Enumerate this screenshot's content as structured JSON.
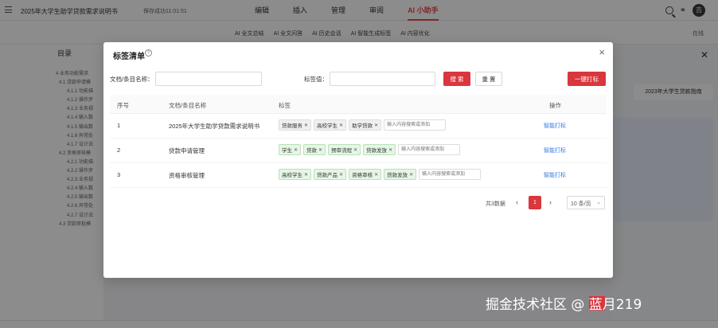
{
  "app": {
    "doc_title": "2025年大学生助学贷款需求说明书",
    "save_status": "保存成功11:01:51",
    "nav": [
      "编辑",
      "插入",
      "管理",
      "审阅",
      "AI 小助手"
    ],
    "avatar_text": "吉"
  },
  "ai_bar": {
    "items": [
      "AI 全文总结",
      "AI 全文问答",
      "AI 历史会话",
      "AI 智能生成标签",
      "AI 内容优化"
    ],
    "online": "在线"
  },
  "sidebar": {
    "title": "目录",
    "items": [
      "4 业务功能需求",
      "4.1 贷款申请模",
      "4.1.1 功能描",
      "4.1.2 操作步",
      "4.1.3 业务规",
      "4.1.4 输入数",
      "4.1.5 输出数",
      "4.1.6 异常处",
      "4.1.7 设计说",
      "4.2 资格审核模",
      "4.2.1 功能描",
      "4.2.2 操作步",
      "4.2.3 业务规",
      "4.2.4 输入数",
      "4.2.5 输出数",
      "4.2.6 异常处",
      "4.2.7 设计说",
      "4.3 贷款审批模"
    ]
  },
  "right_panel": {
    "bubble": "2023年大学生贷款指南"
  },
  "modal": {
    "title": "标签清单",
    "filter": {
      "name_label": "文档/条目名称：",
      "name_value": "",
      "tag_label": "标签值：",
      "tag_value": "",
      "search_label": "搜 索",
      "reset_label": "重 置",
      "batch_label": "一键打标"
    },
    "columns": [
      "序号",
      "文档/条目名称",
      "标签",
      "操作"
    ],
    "rows": [
      {
        "index": "1",
        "name": "2025年大学生助学贷款需求说明书",
        "tags": [
          "贷款服务",
          "高校学生",
          "助学贷款"
        ],
        "tag_style": "gray",
        "input_placeholder": "输入内容搜索或添加",
        "action": "智能打标"
      },
      {
        "index": "2",
        "name": "贷款申请管理",
        "tags": [
          "学生",
          "贷款",
          "预审流程",
          "贷款发放"
        ],
        "tag_style": "green",
        "input_placeholder": "输入内容搜索或添加",
        "action": "智能打标"
      },
      {
        "index": "3",
        "name": "资格审核管理",
        "tags": [
          "高校学生",
          "贷款产品",
          "资格审核",
          "贷款发放"
        ],
        "tag_style": "green",
        "input_placeholder": "输入内容搜索或添加",
        "action": "智能打标"
      }
    ],
    "pagination": {
      "total": "共3数据",
      "current": "1",
      "page_size": "10 条/页"
    }
  },
  "watermark": "掘金技术社区 @ 蓝月219",
  "colors": {
    "accent": "#d9363e",
    "link": "#2f7be5",
    "tag_green": "#e6f6e6",
    "tag_gray": "#f0f0f0"
  }
}
